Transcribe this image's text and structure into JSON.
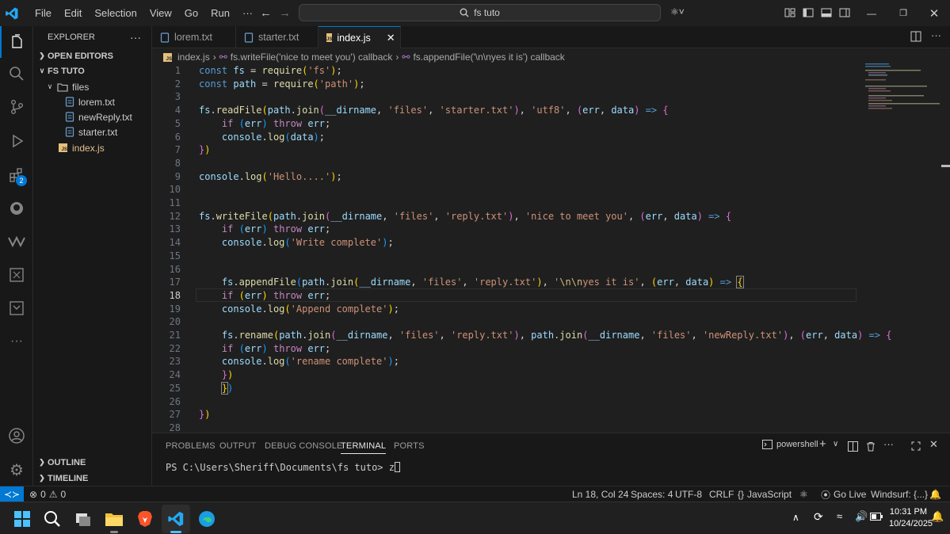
{
  "menu": [
    "File",
    "Edit",
    "Selection",
    "View",
    "Go",
    "Run",
    "···"
  ],
  "search": {
    "text": "fs tuto"
  },
  "sidebar": {
    "header": "EXPLORER",
    "open_editors": "OPEN EDITORS",
    "folder": "FS TUTO",
    "files_folder": "files",
    "files": [
      "lorem.txt",
      "newReply.txt",
      "starter.txt"
    ],
    "root_file": "index.js",
    "outline": "OUTLINE",
    "timeline": "TIMELINE"
  },
  "activity": {
    "extensions_badge": "2"
  },
  "tabs": [
    {
      "label": "lorem.txt"
    },
    {
      "label": "starter.txt"
    },
    {
      "label": "index.js"
    }
  ],
  "breadcrumb": {
    "file": "index.js",
    "sep": "›",
    "seg1": "fs.writeFile('nice to meet you') callback",
    "seg2": "fs.appendFile('\\n\\nyes it is') callback"
  },
  "line_numbers": [
    "1",
    "2",
    "3",
    "4",
    "5",
    "6",
    "7",
    "8",
    "9",
    "10",
    "11",
    "12",
    "13",
    "14",
    "15",
    "16",
    "17",
    "18",
    "19",
    "20",
    "21",
    "22",
    "23",
    "24",
    "25",
    "26",
    "27",
    "28"
  ],
  "panel": {
    "tabs": [
      "PROBLEMS",
      "OUTPUT",
      "DEBUG CONSOLE",
      "TERMINAL",
      "PORTS"
    ],
    "shell": "powershell",
    "prompt": "PS C:\\Users\\Sheriff\\Documents\\fs tuto> z"
  },
  "status": {
    "errors": "0",
    "warnings": "0",
    "position": "Ln 18, Col 24",
    "spaces": "Spaces: 4",
    "encoding": "UTF-8",
    "eol": "CRLF",
    "language": "JavaScript",
    "golive": "Go Live",
    "windsurf": "Windsurf: {...}"
  },
  "taskbar": {
    "time": "10:31 PM",
    "date": "10/24/2025"
  },
  "colors": {
    "accent": "#0078d4",
    "background": "#1f1f1f",
    "sidebar": "#181818"
  }
}
